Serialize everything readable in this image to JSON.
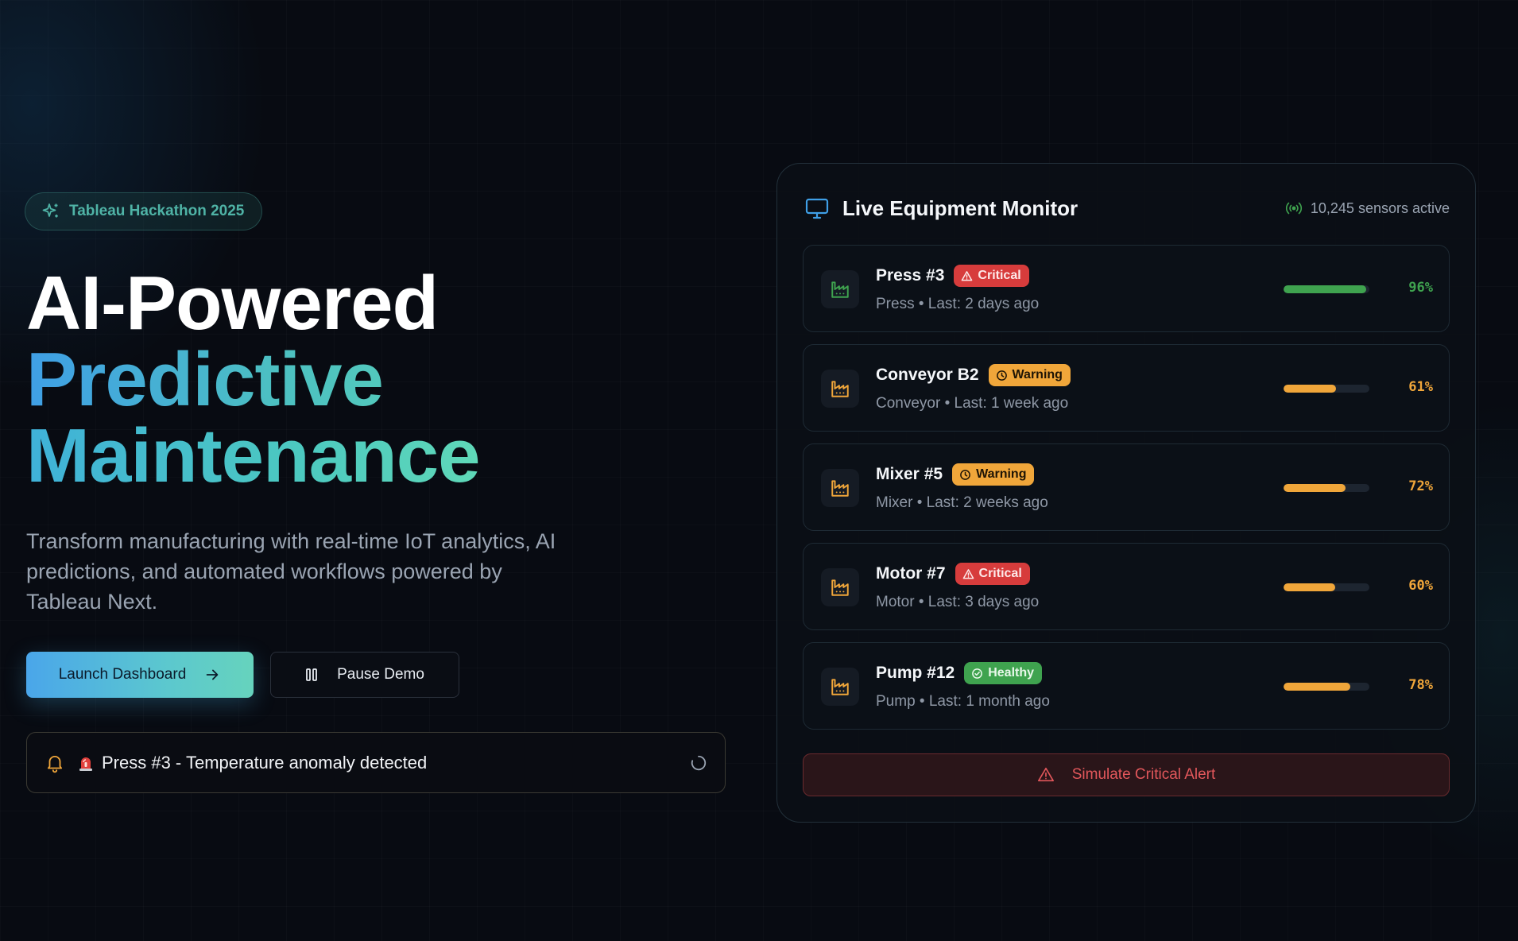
{
  "hero": {
    "badge": "Tableau Hackathon 2025",
    "badge_icon": "sparkles-icon",
    "headline_line1": "AI-Powered",
    "headline_line2": "Predictive",
    "headline_line3": "Maintenance",
    "subtitle": "Transform manufacturing with real-time IoT analytics, AI predictions, and automated workflows powered by Tableau Next.",
    "launch_label": "Launch Dashboard",
    "pause_label": "Pause Demo",
    "alert_text": "Press #3 - Temperature anomaly detected"
  },
  "monitor": {
    "title": "Live Equipment Monitor",
    "sensors": "10,245 sensors active",
    "equipment": [
      {
        "name": "Press #3",
        "status": "Critical",
        "status_type": "critical",
        "subtitle": "Press • Last: 2 days ago",
        "percent_label": "96%",
        "value": 96,
        "icon_color": "#3fa34f",
        "bar_color": "#3fa34f",
        "pct_color": "#3fa34f"
      },
      {
        "name": "Conveyor B2",
        "status": "Warning",
        "status_type": "warning",
        "subtitle": "Conveyor • Last: 1 week ago",
        "percent_label": "61%",
        "value": 61,
        "icon_color": "#f0a63a",
        "bar_color": "#f0a63a",
        "pct_color": "#f0a63a"
      },
      {
        "name": "Mixer #5",
        "status": "Warning",
        "status_type": "warning",
        "subtitle": "Mixer • Last: 2 weeks ago",
        "percent_label": "72%",
        "value": 72,
        "icon_color": "#f0a63a",
        "bar_color": "#f0a63a",
        "pct_color": "#f0a63a"
      },
      {
        "name": "Motor #7",
        "status": "Critical",
        "status_type": "critical",
        "subtitle": "Motor • Last: 3 days ago",
        "percent_label": "60%",
        "value": 60,
        "icon_color": "#f0a63a",
        "bar_color": "#f0a63a",
        "pct_color": "#f0a63a"
      },
      {
        "name": "Pump #12",
        "status": "Healthy",
        "status_type": "healthy",
        "subtitle": "Pump • Last: 1 month ago",
        "percent_label": "78%",
        "value": 78,
        "icon_color": "#f0a63a",
        "bar_color": "#f0a63a",
        "pct_color": "#f0a63a"
      }
    ],
    "simulate_label": "Simulate Critical Alert"
  },
  "colors": {
    "accent_blue": "#4aa6ea",
    "accent_teal": "#5bc7cf",
    "critical": "#d73c3c",
    "warning": "#f0a63a",
    "healthy": "#3fa34f"
  }
}
